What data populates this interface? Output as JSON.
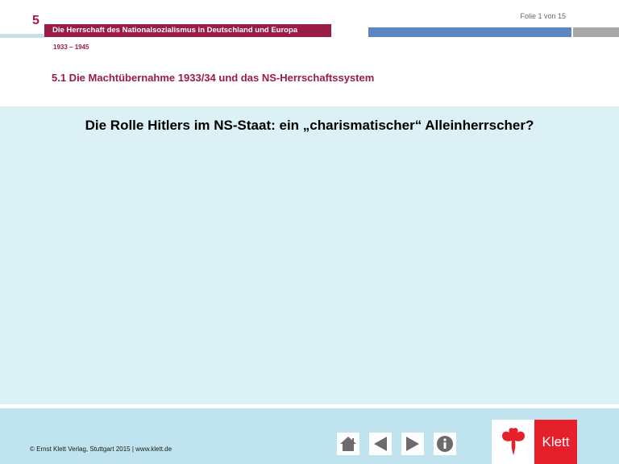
{
  "header": {
    "chapter_number": "5",
    "slide_counter": "Folie 1 von 15",
    "chapter_title": "Die Herrschaft des Nationalsozialismus in Deutschland und Europa",
    "date_range": "1933 – 1945",
    "section_title": "5.1 Die Machtübernahme 1933/34 und das NS-Herrschaftssystem"
  },
  "content": {
    "title": "Die Rolle Hitlers im NS-Staat: ein „charismatischer“ Alleinherrscher?"
  },
  "footer": {
    "copyright": "© Ernst Klett Verlag, Stuttgart 2015 | www.klett.de",
    "logo_text": "Klett"
  },
  "icons": {
    "home": "home-icon",
    "prev": "arrow-left-icon",
    "next": "arrow-right-icon",
    "info": "info-icon"
  },
  "colors": {
    "brand_red": "#9a1b46",
    "accent_blue": "#5b86bf",
    "content_bg": "#dcf1f6",
    "footer_bg": "#bfe4ef",
    "klett_red": "#e5202b"
  }
}
